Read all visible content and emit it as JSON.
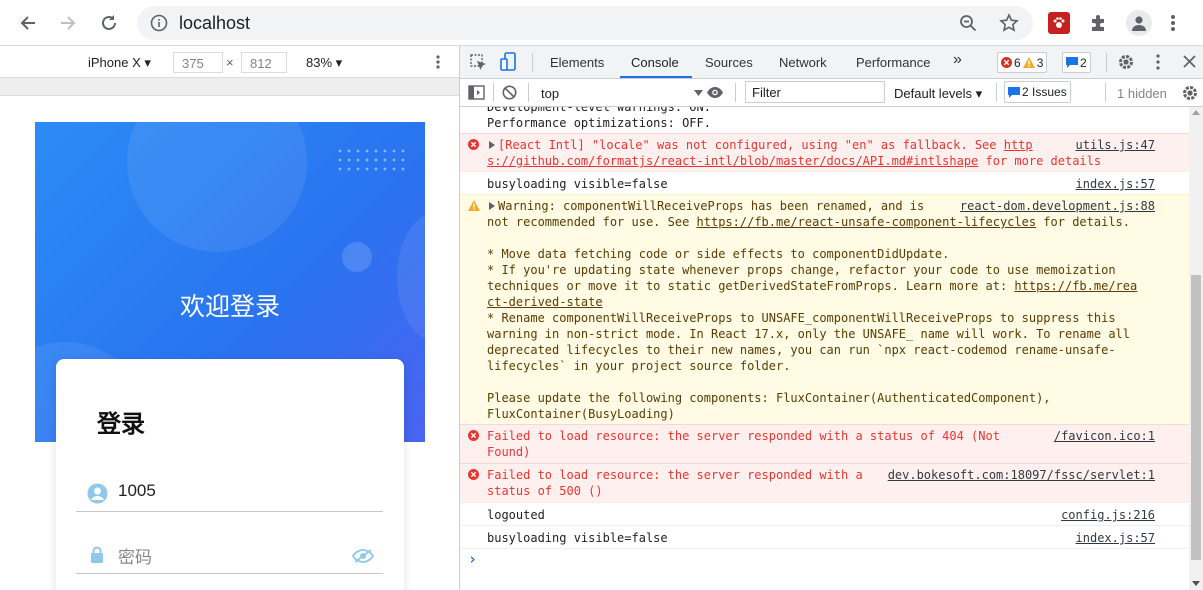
{
  "browser": {
    "url": "localhost",
    "back_icon": "arrow-left-icon",
    "forward_icon": "arrow-right-icon",
    "reload_icon": "reload-icon"
  },
  "device_toolbar": {
    "device": "iPhone X",
    "width": "375",
    "height": "812",
    "times": "×",
    "zoom": "83%"
  },
  "app": {
    "welcome": "欢迎登录",
    "login_title": "登录",
    "username_value": "1005",
    "password_placeholder": "密码"
  },
  "devtools": {
    "tabs": [
      "Elements",
      "Console",
      "Sources",
      "Network",
      "Performance"
    ],
    "more": "»",
    "errors_count": "6",
    "warnings_count": "3",
    "messages_count": "2",
    "context": "top",
    "filter_placeholder": "Filter",
    "levels": "Default levels",
    "issues": "2 Issues",
    "hidden": "1 hidden",
    "prompt": "›"
  },
  "console": {
    "e0": {
      "l1": "Development-level warnings: ON.",
      "l2": "Performance optimizations: OFF."
    },
    "e1": {
      "a": "[React Intl] \"locale\" was not configured, using \"en\" as fallback. See ",
      "link1": "http",
      "link2": "s://github.com/formatjs/react-intl/blob/master/docs/API.md#intlshape",
      "b": " for more details",
      "src": "utils.js:47"
    },
    "e2": {
      "msg": "busyloading visible=false",
      "src": "index.js:57"
    },
    "e3": {
      "l1": "Warning: componentWillReceiveProps has been renamed, and is",
      "l2a": "not recommended for use. See ",
      "l2link": "https://fb.me/react-unsafe-component-lifecycles",
      "l2b": " for details.",
      "l4": "* Move data fetching code or side effects to componentDidUpdate.",
      "l5": "* If you're updating state whenever props change, refactor your code to use memoization",
      "l6a": "techniques or move it to static getDerivedStateFromProps. Learn more at: ",
      "l6link": "https://fb.me/rea",
      "l7link": "ct-derived-state",
      "l8": "* Rename componentWillReceiveProps to UNSAFE_componentWillReceiveProps to suppress this",
      "l9": "warning in non-strict mode. In React 17.x, only the UNSAFE_ name will work. To rename all",
      "l10": "deprecated lifecycles to their new names, you can run `npx react-codemod rename-unsafe-",
      "l11": "lifecycles` in your project source folder.",
      "l13": "Please update the following components: FluxContainer(AuthenticatedComponent),",
      "l14": "FluxContainer(BusyLoading)",
      "src": "react-dom.development.js:88"
    },
    "e4": {
      "l1": "Failed to load resource: the server responded with a status of 404 (Not",
      "l2": "Found)",
      "src": "/favicon.ico:1"
    },
    "e5": {
      "l1": "Failed to load resource: the server responded with a ",
      "l2": "status of 500 ()",
      "src": "dev.bokesoft.com:18097/fssc/servlet:1"
    },
    "e6": {
      "msg": "logouted",
      "src": "config.js:216"
    },
    "e7": {
      "msg": "busyloading visible=false",
      "src": "index.js:57"
    }
  }
}
